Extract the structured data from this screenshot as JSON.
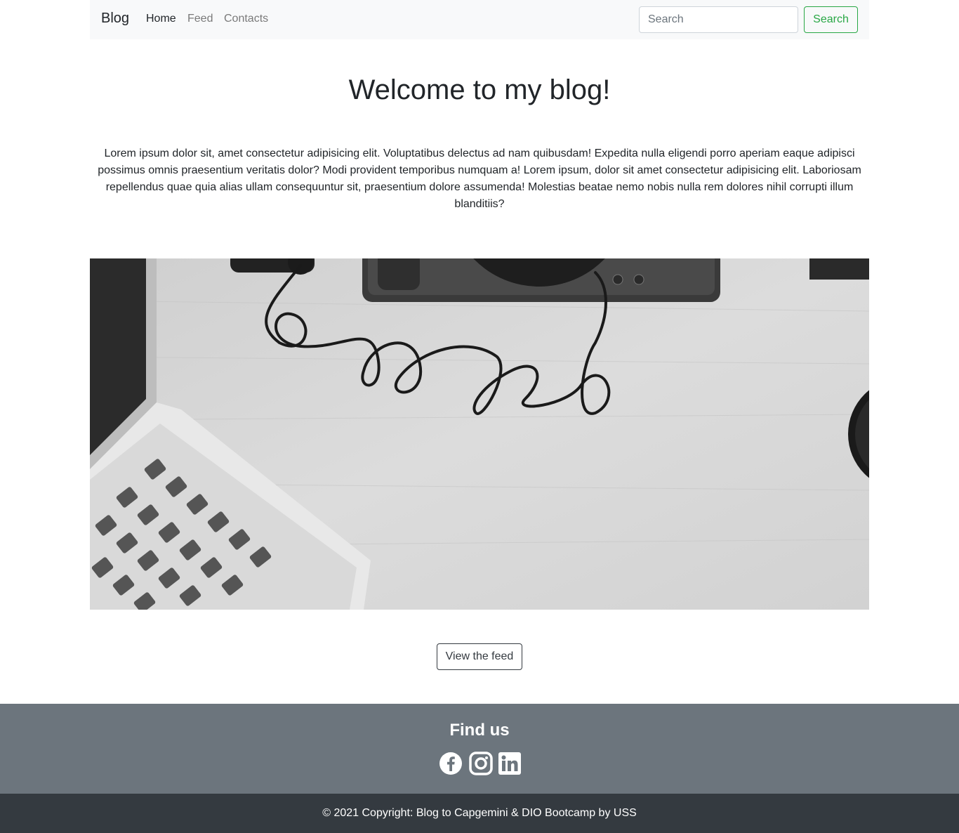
{
  "navbar": {
    "brand": "Blog",
    "links": [
      {
        "label": "Home",
        "active": true
      },
      {
        "label": "Feed",
        "active": false
      },
      {
        "label": "Contacts",
        "active": false
      }
    ],
    "search_placeholder": "Search",
    "search_button": "Search"
  },
  "main": {
    "title": "Welcome to my blog!",
    "intro": "Lorem ipsum dolor sit, amet consectetur adipisicing elit. Voluptatibus delectus ad nam quibusdam! Expedita nulla eligendi porro aperiam eaque adipisci possimus omnis praesentium veritatis dolor? Modi provident temporibus numquam a! Lorem ipsum, dolor sit amet consectetur adipisicing elit. Laboriosam repellendus quae quia alias ullam consequuntur sit, praesentium dolore assumenda! Molestias beatae nemo nobis nulla rem dolores nihil corrupti illum blanditiis?",
    "feed_button": "View the feed"
  },
  "footer": {
    "title": "Find us",
    "social": [
      "facebook-icon",
      "instagram-icon",
      "linkedin-icon"
    ],
    "copyright": "© 2021 Copyright: Blog to Capgemini & DIO Bootcamp by USS"
  },
  "colors": {
    "navbar_bg": "#f8f9fa",
    "success": "#28a745",
    "footer_top": "#6c757d",
    "footer_bottom": "#343a40"
  }
}
